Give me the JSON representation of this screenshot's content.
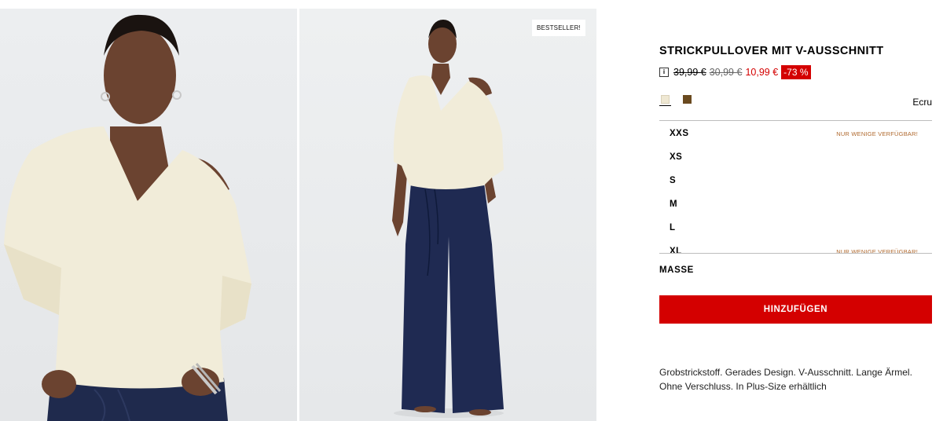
{
  "gallery": {
    "badge": "BESTSELLER!"
  },
  "product": {
    "title": "STRICKPULLOVER MIT V-AUSSCHNITT",
    "price_original": "39,99 €",
    "price_previous": "30,99 €",
    "price_current": "10,99 €",
    "discount": "-73 %",
    "info_icon": "info-icon",
    "colors": [
      {
        "name": "ecru-swatch",
        "hex": "#efe8d3"
      },
      {
        "name": "brown-swatch",
        "hex": "#6a4a1f"
      }
    ],
    "selected_color": "Ecru",
    "sizes": [
      {
        "label": "XXS",
        "note": "NUR WENIGE VERFÜGBAR!"
      },
      {
        "label": "XS",
        "note": ""
      },
      {
        "label": "S",
        "note": ""
      },
      {
        "label": "M",
        "note": ""
      },
      {
        "label": "L",
        "note": ""
      },
      {
        "label": "XL",
        "note": "NUR WENIGE VERFÜGBAR!"
      }
    ],
    "masse_label": "MASSE",
    "add_button": "HINZUFÜGEN",
    "description": "Grobstrickstoff. Gerades Design. V-Ausschnitt. Lange Ärmel. Ohne Verschluss. In Plus-Size erhältlich"
  },
  "colors": {
    "accent": "#d40000",
    "low_stock": "#b0692e"
  }
}
